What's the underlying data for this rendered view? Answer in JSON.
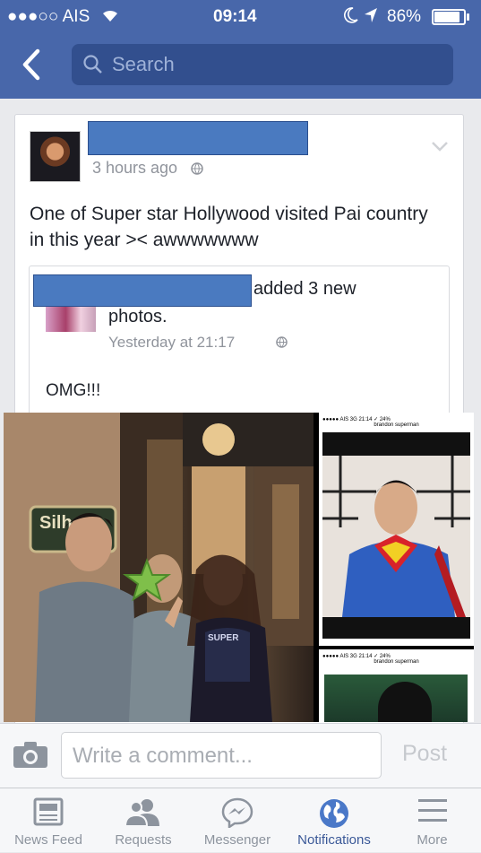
{
  "status": {
    "carrier": "●●●○○ AIS",
    "time": "09:14",
    "battery": "86%",
    "battery_fraction": 0.86
  },
  "nav": {
    "search_placeholder": "Search"
  },
  "post": {
    "time": "3 hours ago",
    "text": "One of Super star Hollywood visited Pai country in this year >< awwwwwww",
    "shared": {
      "action": "added 3 new",
      "action2": "photos.",
      "time": "Yesterday at 21:17",
      "text": "OMG!!!"
    },
    "photo": {
      "sign_text": "Silho",
      "shirt_text": "SUPER",
      "thumb_status": "●●●●● AIS  3G      21:14      ✓ 24%",
      "thumb_caption": "brandon superman"
    }
  },
  "comment": {
    "placeholder": "Write a comment...",
    "post_label": "Post"
  },
  "tabs": [
    {
      "label": "News Feed"
    },
    {
      "label": "Requests"
    },
    {
      "label": "Messenger"
    },
    {
      "label": "Notifications"
    },
    {
      "label": "More"
    }
  ],
  "colors": {
    "brand": "#4867aa",
    "active_tab": "#3b5998",
    "inactive_tab": "#8d949e"
  }
}
